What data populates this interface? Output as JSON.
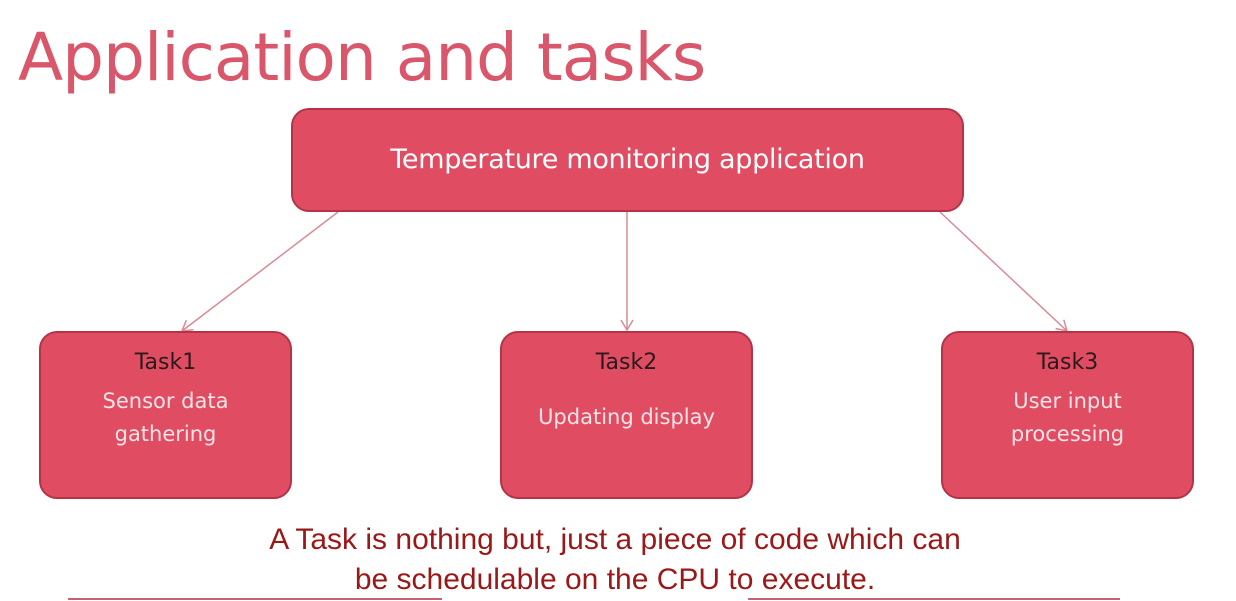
{
  "slide": {
    "title": "Application and tasks"
  },
  "diagram": {
    "application": {
      "label": "Temperature monitoring application"
    },
    "tasks": [
      {
        "name": "Task1",
        "description": "Sensor data gathering"
      },
      {
        "name": "Task2",
        "description": "Updating display"
      },
      {
        "name": "Task3",
        "description": "User input processing"
      }
    ]
  },
  "caption": {
    "line1": "A Task is nothing but, just a piece of code which can",
    "line2": "be schedulable on the CPU to execute."
  },
  "colors": {
    "title": "#d9566b",
    "box_fill": "#e04d63",
    "box_border": "#b53347",
    "connector": "#d98a95",
    "caption": "#9a1818"
  }
}
